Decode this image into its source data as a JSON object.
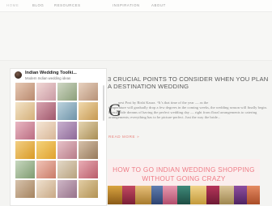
{
  "nav": {
    "items": [
      {
        "label": "HOME"
      },
      {
        "label": "BLOG"
      },
      {
        "label": "RESOURCES"
      },
      {
        "label": "INSPIRATION"
      },
      {
        "label": "ABOUT"
      }
    ],
    "active": "HOME"
  },
  "widget": {
    "title": "Indian Wedding Toolki...",
    "subtitle": "Modern Indian wedding ideas"
  },
  "post": {
    "title": "3 CRUCIAL POINTS TO CONSIDER WHEN YOU PLAN A DESTINATION WEDDING",
    "dropcap": "G",
    "excerpt_first": "uest Post by Rishi Kaura.  “It’s that time of the year — as the",
    "excerpt_rest": "temperature will gradually drop a few degrees in the coming weeks, the wedding season will finally begin. Every bride dreams of having the perfect wedding day — right from floral arrangements to catering arrangements; everything has to be picture-perfect. Just the way the bride...",
    "read_more": "READ MORE »"
  },
  "banner": {
    "line1": "HOW TO GO INDIAN WEDDING SHOPPING",
    "line2": "WITHOUT GOING CRAZY"
  },
  "colors": {
    "accent": "#e8807a",
    "banner_text": "#ee7c86",
    "banner_bg": "#fbeeee"
  },
  "icons": {
    "avatar": "profile-avatar"
  }
}
